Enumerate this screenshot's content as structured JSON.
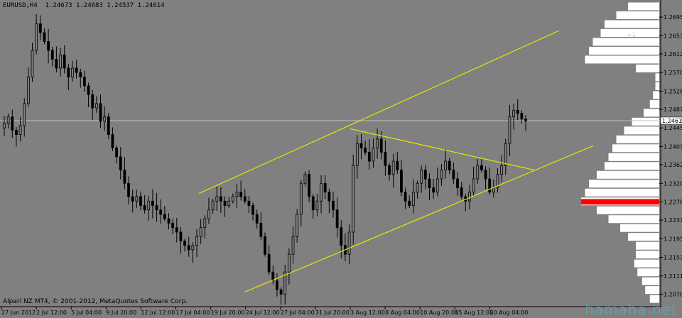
{
  "header": {
    "symbol_line": "EURUSD,H4  1.24673 1.24683 1.24537 1.24614"
  },
  "footer": {
    "copyright": "Alpari NZ MT4, © 2001-2012, MetaQuotes Software Corp."
  },
  "watermark": "hamaha.net",
  "faint_tag": "+1",
  "colors": {
    "background": "#808080",
    "candle": "#000000",
    "trendline": "#e6e600",
    "price_line": "#c0c0c0",
    "profile": "#ffffff",
    "profile_peak": "#ff0000",
    "axis_text": "#000000"
  },
  "chart_data": {
    "type": "candlestick",
    "symbol": "EURUSD",
    "timeframe": "H4",
    "last_price_label": "1.24614",
    "ylim": [
      1.2045,
      1.2724
    ],
    "y_ticks": [
      "1.26950",
      "1.26530",
      "1.26120",
      "1.25700",
      "1.25280",
      "1.24870",
      "1.24450",
      "1.24030",
      "1.23620",
      "1.23200",
      "1.22780",
      "1.22370",
      "1.21950",
      "1.21530",
      "1.21110",
      "1.20700"
    ],
    "x_ticks": [
      "27 Jun 2012",
      "2 Jul 12:00",
      "5 Jul 04:00",
      "9 Jul 20:00",
      "12 Jul 12:00",
      "17 Jul 04:00",
      "19 Jul 20:00",
      "24 Jul 12:00",
      "27 Jul 04:00",
      "31 Jul 20:00",
      "3 Aug 12:00",
      "8 Aug 04:00",
      "10 Aug 20:00",
      "15 Aug 12:00",
      "20 Aug 04:00"
    ],
    "closes": [
      1.2455,
      1.247,
      1.244,
      1.243,
      1.245,
      1.25,
      1.256,
      1.262,
      1.268,
      1.266,
      1.264,
      1.262,
      1.26,
      1.258,
      1.261,
      1.258,
      1.256,
      1.258,
      1.257,
      1.256,
      1.254,
      1.252,
      1.249,
      1.25,
      1.246,
      1.247,
      1.243,
      1.24,
      1.238,
      1.235,
      1.232,
      1.229,
      1.228,
      1.229,
      1.227,
      1.226,
      1.228,
      1.227,
      1.226,
      1.225,
      1.224,
      1.223,
      1.222,
      1.221,
      1.219,
      1.218,
      1.217,
      1.218,
      1.22,
      1.222,
      1.224,
      1.226,
      1.228,
      1.229,
      1.228,
      1.227,
      1.228,
      1.229,
      1.23,
      1.229,
      1.228,
      1.227,
      1.225,
      1.223,
      1.22,
      1.216,
      1.212,
      1.21,
      1.208,
      1.207,
      1.212,
      1.216,
      1.22,
      1.225,
      1.232,
      1.234,
      1.229,
      1.226,
      1.228,
      1.232,
      1.23,
      1.228,
      1.226,
      1.222,
      1.218,
      1.216,
      1.221,
      1.236,
      1.241,
      1.24,
      1.239,
      1.237,
      1.24,
      1.242,
      1.239,
      1.236,
      1.234,
      1.237,
      1.235,
      1.23,
      1.228,
      1.227,
      1.23,
      1.232,
      1.235,
      1.233,
      1.231,
      1.23,
      1.233,
      1.235,
      1.237,
      1.235,
      1.233,
      1.231,
      1.229,
      1.228,
      1.23,
      1.233,
      1.236,
      1.235,
      1.233,
      1.23,
      1.231,
      1.234,
      1.236,
      1.241,
      1.247,
      1.2485,
      1.2478,
      1.2465,
      1.2461
    ],
    "trendlines": [
      {
        "name": "upper-channel",
        "from": [
          0.3,
          1.2297
        ],
        "to": [
          0.847,
          1.2664
        ]
      },
      {
        "name": "lower-channel",
        "from": [
          0.37,
          1.2075
        ],
        "to": [
          0.9,
          1.2405
        ]
      },
      {
        "name": "down-trend",
        "from": [
          0.53,
          1.2443
        ],
        "to": [
          0.81,
          1.235
        ]
      }
    ],
    "price_line": 1.24614,
    "volume_profile": [
      [
        1.272,
        0.4
      ],
      [
        1.27,
        0.55
      ],
      [
        1.268,
        0.7
      ],
      [
        1.266,
        0.75
      ],
      [
        1.264,
        0.85
      ],
      [
        1.262,
        0.9
      ],
      [
        1.26,
        0.95
      ],
      [
        1.258,
        0.3
      ],
      [
        1.256,
        0.05
      ],
      [
        1.254,
        0.05
      ],
      [
        1.252,
        0.08
      ],
      [
        1.25,
        0.12
      ],
      [
        1.248,
        0.2
      ],
      [
        1.246,
        0.35
      ],
      [
        1.244,
        0.45
      ],
      [
        1.242,
        0.55
      ],
      [
        1.24,
        0.6
      ],
      [
        1.238,
        0.65
      ],
      [
        1.236,
        0.7
      ],
      [
        1.234,
        0.8
      ],
      [
        1.232,
        0.9
      ],
      [
        1.23,
        0.95
      ],
      [
        1.228,
        1.0
      ],
      [
        1.226,
        0.8
      ],
      [
        1.224,
        0.65
      ],
      [
        1.222,
        0.5
      ],
      [
        1.22,
        0.4
      ],
      [
        1.218,
        0.3
      ],
      [
        1.216,
        0.3
      ],
      [
        1.214,
        0.32
      ],
      [
        1.212,
        0.28
      ],
      [
        1.21,
        0.22
      ],
      [
        1.208,
        0.18
      ],
      [
        1.206,
        0.12
      ]
    ],
    "volume_profile_peak": [
      1.2274,
      1.2285
    ]
  }
}
